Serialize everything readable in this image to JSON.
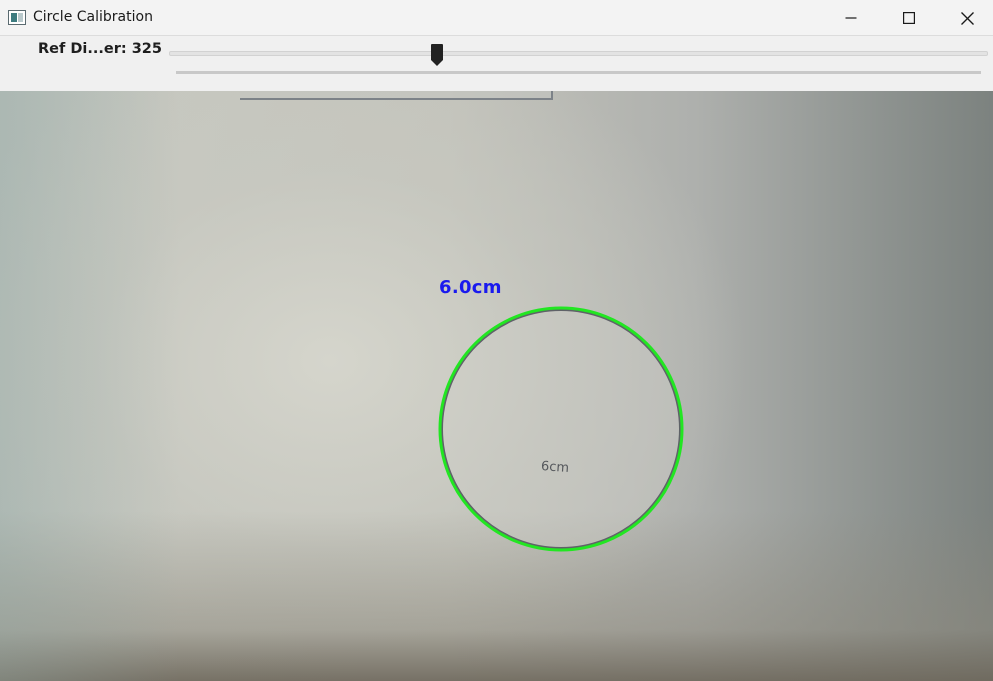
{
  "window": {
    "title": "Circle Calibration",
    "icon": "app-window-icon",
    "controls": {
      "minimize_icon": "minimize-icon",
      "maximize_icon": "maximize-icon",
      "close_icon": "close-icon"
    }
  },
  "trackbar": {
    "label": "Ref Di...er: 325",
    "value": 325,
    "position_fraction": 0.327,
    "thumb_color": "#222222"
  },
  "camera": {
    "detected_circle": {
      "measurement_label": "6.0cm",
      "measurement_color": "#1a1aee",
      "outline_color": "#22e622"
    },
    "paper_text": "6cm"
  }
}
